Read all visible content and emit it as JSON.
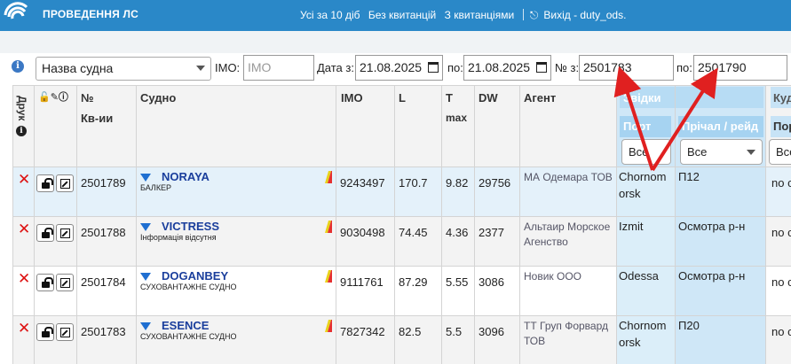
{
  "header": {
    "app_title": "ПРОВЕДЕННЯ ЛС",
    "nav": {
      "all10": "Усі за 10 діб",
      "no_receipts": "Без квитанцій",
      "with_receipts": "З квитанціями",
      "logout": "Вихід - duty_ods."
    },
    "accent": "#2a88c8"
  },
  "filters": {
    "field_select": "Назва судна",
    "imo_label": "IMO:",
    "imo_placeholder": "IMO",
    "date_from_label": "Дата з:",
    "date_from": "21.08.2025",
    "date_to_label": "по:",
    "date_to": "21.08.2025",
    "num_from_label": "№ з:",
    "num_from": "2501783",
    "num_to_label": "по:",
    "num_to": "2501790"
  },
  "table": {
    "headers": {
      "print": "Друк",
      "num": "№",
      "num2": "Кв-ии",
      "ship": "Судно",
      "imo": "IMO",
      "l": "L",
      "t": "T",
      "t2": "max",
      "dw": "DW",
      "agent": "Агент",
      "from_group": "Звідки",
      "port": "Порт",
      "berth": "Прічал / рейд",
      "kud_group": "Куд",
      "kud_port": "Пор"
    },
    "filter_all": "Все",
    "rows": [
      {
        "num": "2501789",
        "ship": "NORAYA",
        "type": "БАЛКЕР",
        "imo": "9243497",
        "l": "170.7",
        "t": "9.82",
        "dw": "29756",
        "agent1": "МА Одемара ТОВ",
        "agent2": "",
        "port1": "Chornom",
        "port2": "orsk",
        "berth": "П12",
        "kud": "no c"
      },
      {
        "num": "2501788",
        "ship": "VICTRESS",
        "type": "Інформація відсутня",
        "imo": "9030498",
        "l": "74.45",
        "t": "4.36",
        "dw": "2377",
        "agent1": "Альтаир Морское",
        "agent2": "Агенство",
        "port1": "Izmit",
        "port2": "",
        "berth": "Осмотра р-н",
        "kud": "no c"
      },
      {
        "num": "2501784",
        "ship": "DOGANBEY",
        "type": "СУХОВАНТАЖНЕ СУДНО",
        "imo": "9111761",
        "l": "87.29",
        "t": "5.55",
        "dw": "3086",
        "agent1": "Новик ООО",
        "agent2": "",
        "port1": "Odessa",
        "port2": "",
        "berth": "Осмотра р-н",
        "kud": "no c"
      },
      {
        "num": "2501783",
        "ship": "ESENCE",
        "type": "СУХОВАНТАЖНЕ СУДНО",
        "imo": "7827342",
        "l": "82.5",
        "t": "5.5",
        "dw": "3096",
        "agent1": "ТТ Груп Форвард",
        "agent2": "ТОВ",
        "port1": "Chornom",
        "port2": "orsk",
        "berth": "П20",
        "kud": "no c"
      }
    ]
  },
  "icons": {
    "delete": "delete-x-icon",
    "unlock": "unlock-icon",
    "edit": "edit-icon",
    "info": "info-icon",
    "flag": "yellow-red-flag-icon",
    "arrow": "red-arrow-annotation"
  }
}
